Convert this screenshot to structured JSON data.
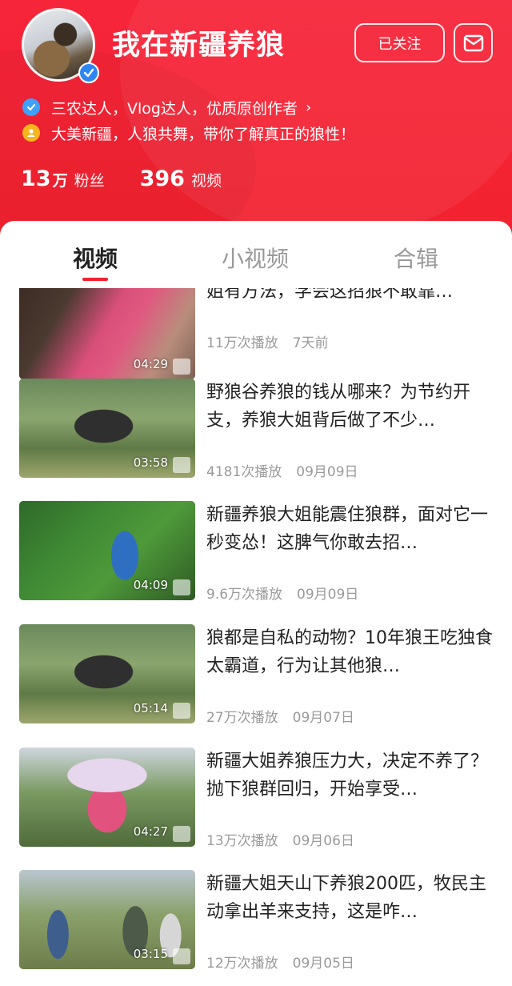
{
  "profile": {
    "name": "我在新疆养狼",
    "follow_label": "已关注",
    "cert_text": "三农达人，Vlog达人，优质原创作者",
    "bio": "大美新疆，人狼共舞，带你了解真正的狼性！",
    "fans_num": "13",
    "fans_unit": "万",
    "fans_label": "粉丝",
    "videos_num": "396",
    "videos_label": "视频"
  },
  "tabs": [
    {
      "label": "视频",
      "active": true
    },
    {
      "label": "小视频",
      "active": false
    },
    {
      "label": "合辑",
      "active": false
    }
  ],
  "videos": [
    {
      "title": "姐有方法，学会这招狼不敢靠…",
      "duration": "04:29",
      "plays": "11万次播放",
      "date": "7天前"
    },
    {
      "title": "野狼谷养狼的钱从哪来？为节约开支，养狼大姐背后做了不少…",
      "duration": "03:58",
      "plays": "4181次播放",
      "date": "09月09日"
    },
    {
      "title": "新疆养狼大姐能震住狼群，面对它一秒变怂！这脾气你敢去招…",
      "duration": "04:09",
      "plays": "9.6万次播放",
      "date": "09月09日"
    },
    {
      "title": "狼都是自私的动物？10年狼王吃独食太霸道，行为让其他狼…",
      "duration": "05:14",
      "plays": "27万次播放",
      "date": "09月07日"
    },
    {
      "title": "新疆大姐养狼压力大，决定不养了？抛下狼群回归，开始享受…",
      "duration": "04:27",
      "plays": "13万次播放",
      "date": "09月06日"
    },
    {
      "title": "新疆大姐天山下养狼200匹，牧民主动拿出羊来支持，这是咋…",
      "duration": "03:15",
      "plays": "12万次播放",
      "date": "09月05日"
    }
  ],
  "colors": {
    "brand_red": "#f2222f",
    "verify_blue": "#2e86f2",
    "cert_blue": "#3ea1ff",
    "person_yellow": "#f6b51d"
  },
  "icons": [
    "verified-icon",
    "mail-icon",
    "cert-icon",
    "person-icon",
    "chevron-right-icon"
  ]
}
